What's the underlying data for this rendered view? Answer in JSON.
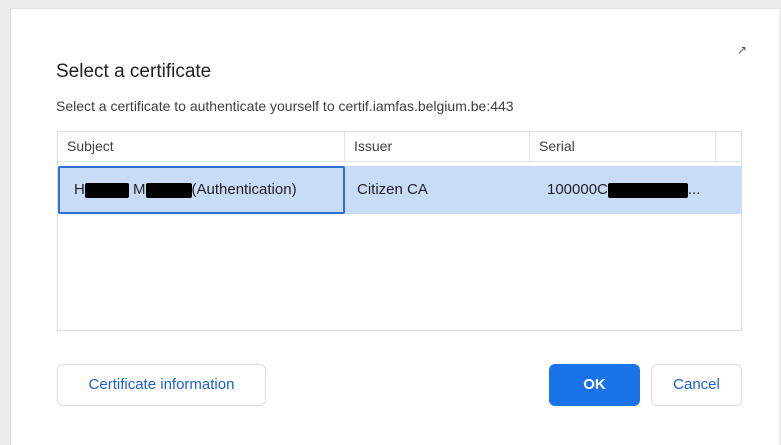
{
  "dialog": {
    "title": "Select a certificate",
    "subtitle": "Select a certificate to authenticate yourself to certif.iamfas.belgium.be:443",
    "close_icon": "resize-arrow-icon"
  },
  "table": {
    "columns": [
      "Subject",
      "Issuer",
      "Serial"
    ],
    "rows": [
      {
        "subject_prefix": "H",
        "subject_middle": "M",
        "subject_suffix": "(Authentication)",
        "issuer": "Citizen CA",
        "serial_prefix": "100000C",
        "serial_suffix": "..."
      }
    ]
  },
  "buttons": {
    "info": "Certificate information",
    "ok": "OK",
    "cancel": "Cancel"
  },
  "colors": {
    "selected_row": "#c9dcf7",
    "selected_border": "#2f6fd3",
    "primary": "#1a73e8",
    "link_text": "#1a5fd0"
  }
}
